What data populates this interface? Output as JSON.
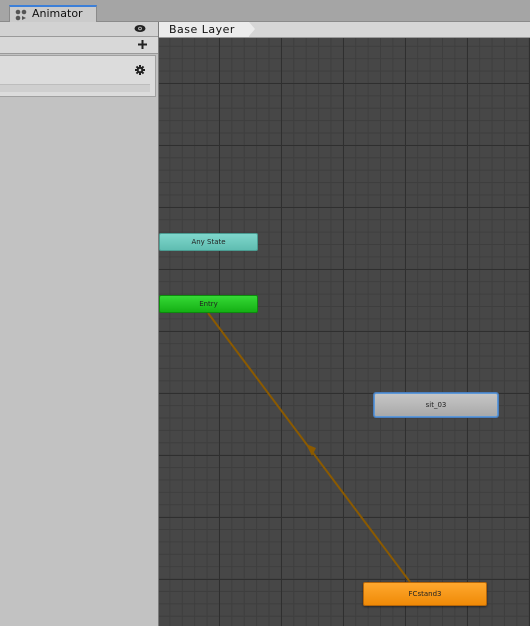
{
  "window": {
    "tab_label": "Animator",
    "tab_icon": "animator-icon"
  },
  "left_panel": {
    "icons": [
      "eye-icon",
      "plus-icon",
      "gear-icon"
    ]
  },
  "graph": {
    "breadcrumb": "Base Layer",
    "nodes": {
      "any_state": "Any State",
      "entry": "Entry",
      "sit": "sit_03",
      "fcstand": "FCstand3"
    },
    "transition": {
      "from": "Entry",
      "to": "FCstand3"
    },
    "colors": {
      "any_state": "#6ccac0",
      "entry": "#22c422",
      "default_state": "#f7971a",
      "state": "#b9b9b9",
      "selected_border": "#4a7fbf",
      "transition": "#8b5a00",
      "tab_accent": "#3c7fd8"
    }
  }
}
